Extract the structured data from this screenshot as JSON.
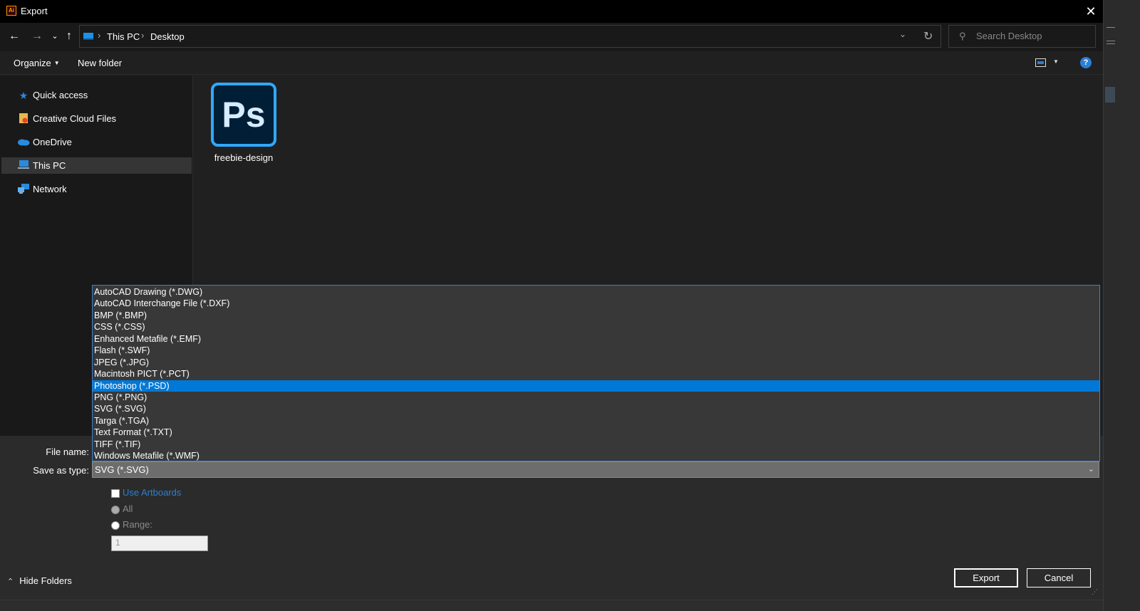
{
  "window": {
    "title": "Export",
    "app_icon_text": "Ai"
  },
  "address": {
    "breadcrumbs": [
      "This PC",
      "Desktop"
    ],
    "search_placeholder": "Search Desktop"
  },
  "toolbar": {
    "organize_label": "Organize",
    "new_folder_label": "New folder"
  },
  "nav_pane": {
    "items": [
      {
        "label": "Quick access",
        "icon": "star-icon",
        "color": "#2a8ae0"
      },
      {
        "label": "Creative Cloud Files",
        "icon": "cc-folder-icon",
        "color": "#e9b84a"
      },
      {
        "label": "OneDrive",
        "icon": "cloud-icon",
        "color": "#2a8ae0"
      },
      {
        "label": "This PC",
        "icon": "computer-icon",
        "color": "#2a8ae0",
        "selected": true
      },
      {
        "label": "Network",
        "icon": "network-icon",
        "color": "#2a8ae0"
      }
    ]
  },
  "files": [
    {
      "name": "freebie-design",
      "icon": "photoshop-icon",
      "icon_text": "Ps"
    }
  ],
  "form": {
    "file_name_label": "File name:",
    "save_as_type_label": "Save as type:",
    "save_as_type_value": "SVG (*.SVG)",
    "type_options": [
      "AutoCAD Drawing (*.DWG)",
      "AutoCAD Interchange File (*.DXF)",
      "BMP (*.BMP)",
      "CSS (*.CSS)",
      "Enhanced Metafile (*.EMF)",
      "Flash (*.SWF)",
      "JPEG (*.JPG)",
      "Macintosh PICT (*.PCT)",
      "Photoshop (*.PSD)",
      "PNG (*.PNG)",
      "SVG (*.SVG)",
      "Targa (*.TGA)",
      "Text Format (*.TXT)",
      "TIFF (*.TIF)",
      "Windows Metafile (*.WMF)"
    ],
    "highlighted_option": "Photoshop (*.PSD)",
    "use_artboards_label": "Use Artboards",
    "all_label": "All",
    "range_label": "Range:",
    "range_value": "1"
  },
  "footer": {
    "hide_folders_label": "Hide Folders",
    "export_label": "Export",
    "cancel_label": "Cancel"
  },
  "colors": {
    "accent": "#0078d7",
    "link_blue": "#2a7fd4",
    "ps_blue": "#31a8ff",
    "ps_bg": "#001e36"
  }
}
